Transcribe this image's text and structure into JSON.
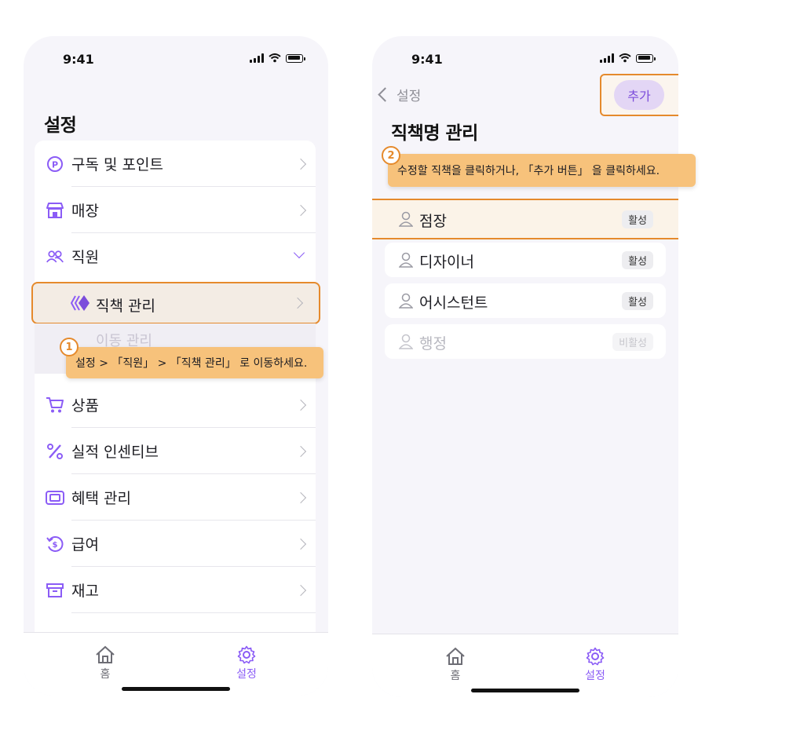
{
  "status_bar": {
    "time": "9:41"
  },
  "phone1": {
    "title": "설정",
    "menu": [
      {
        "label": "구독 및 포인트",
        "icon": "point-coin-icon"
      },
      {
        "label": "매장",
        "icon": "store-icon"
      },
      {
        "label": "직원",
        "icon": "people-icon"
      },
      {
        "label": "상품",
        "icon": "cart-icon"
      },
      {
        "label": "실적 인센티브",
        "icon": "percent-icon"
      },
      {
        "label": "혜택 관리",
        "icon": "ticket-icon"
      },
      {
        "label": "급여",
        "icon": "pay-icon"
      },
      {
        "label": "재고",
        "icon": "box-icon"
      }
    ],
    "sub_item": {
      "label": "직책 관리",
      "icon": "diamond-icon"
    },
    "partial_hidden_label": "이동 관리",
    "tooltip": {
      "step": "1",
      "text": "설정 > 「직원」 > 「직책 관리」 로 이동하세요."
    }
  },
  "phone2": {
    "back_label": "설정",
    "add_button": "추가",
    "title": "직책명 관리",
    "tooltip": {
      "step": "2",
      "text": "수정할 직책을 클릭하거나, 「추가 버튼」 을 클릭하세요."
    },
    "roles": [
      {
        "name": "점장",
        "status": "활성"
      },
      {
        "name": "디자이너",
        "status": "활성"
      },
      {
        "name": "어시스턴트",
        "status": "활성"
      },
      {
        "name": "행정",
        "status": "비활성"
      }
    ]
  },
  "tabbar": {
    "home": "홈",
    "settings": "설정"
  },
  "colors": {
    "accent": "#8b5cf6",
    "highlight": "#e58a2c",
    "tooltip": "#f7c27b"
  }
}
